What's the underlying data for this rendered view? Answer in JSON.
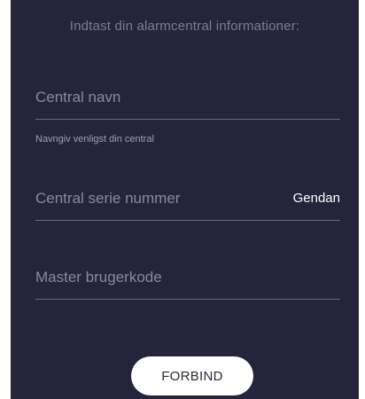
{
  "header": {
    "title": "Indtast din alarmcentral informationer:"
  },
  "form": {
    "central_name": {
      "placeholder": "Central navn",
      "value": "",
      "hint": "Navngiv venligst din central"
    },
    "serial_number": {
      "placeholder": "Central serie nummer",
      "value": "",
      "restore_label": "Gendan"
    },
    "master_code": {
      "placeholder": "Master brugerkode",
      "value": ""
    }
  },
  "actions": {
    "connect_label": "FORBIND"
  },
  "colors": {
    "background": "#24243a",
    "button": "#ffffff",
    "underline": "#6a6a80"
  }
}
